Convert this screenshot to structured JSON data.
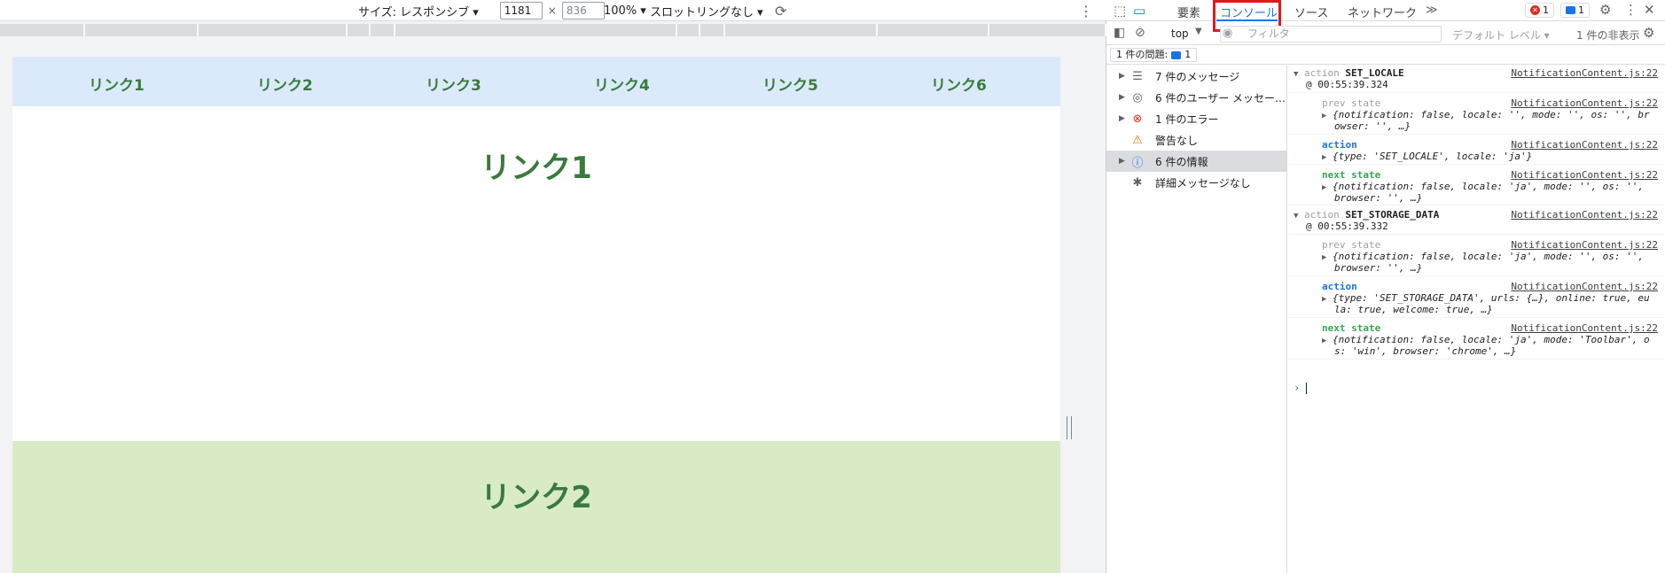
{
  "device_toolbar": {
    "size_label": "サイズ: レスポンシブ ▾",
    "width_value": "1181",
    "height_value": "836",
    "times": "×",
    "zoom": "100% ▾",
    "throttle": "スロットリングなし ▾"
  },
  "page": {
    "nav": [
      "リンク1",
      "リンク2",
      "リンク3",
      "リンク4",
      "リンク5",
      "リンク6"
    ],
    "section1_title": "リンク1",
    "section2_title": "リンク2",
    "section1_bg": "#ffffff",
    "section2_bg": "#d9ebc4",
    "nav_bg": "#dbeafb",
    "text_color": "#3a7a3e"
  },
  "devtools": {
    "tabs": [
      "要素",
      "コンソール",
      "ソース",
      "ネットワーク"
    ],
    "active_tab": "コンソール",
    "more_tabs": "≫",
    "error_badge": "1",
    "message_badge": "1",
    "context": "top",
    "filter_placeholder": "フィルタ",
    "levels": "デフォルト レベル ▾",
    "hidden": "1 件の非表示",
    "issues": "1 件の問題:",
    "issues_count": "1",
    "sidebar": [
      {
        "label": "7 件のメッセージ",
        "icon": "list-icon"
      },
      {
        "label": "6 件のユーザー メッセー…",
        "icon": "user-icon"
      },
      {
        "label": "1 件のエラー",
        "icon": "error-icon"
      },
      {
        "label": "警告なし",
        "icon": "warning-icon"
      },
      {
        "label": "6 件の情報",
        "icon": "info-icon"
      },
      {
        "label": "詳細メッセージなし",
        "icon": "bug-icon"
      }
    ],
    "console": {
      "file": "NotificationContent.js:22",
      "g1_head": "action",
      "g1_name": "SET_LOCALE",
      "g1_time": "@ 00:55:39.324",
      "g1_prev_label": "prev state",
      "g1_prev_1": "{notification: false, locale: '', mode: '', os: '', br",
      "g1_prev_2": "owser: '', …}",
      "g1_action_label": "action",
      "g1_action_1": "{type: 'SET_LOCALE', locale: 'ja'}",
      "g1_next_label": "next state",
      "g1_next_1": "{notification: false, locale: 'ja', mode: '', os: '',",
      "g1_next_2": "browser: '', …}",
      "g2_head": "action",
      "g2_name": "SET_STORAGE_DATA",
      "g2_time": "@ 00:55:39.332",
      "g2_prev_label": "prev state",
      "g2_prev_1": "{notification: false, locale: 'ja', mode: '', os: '',",
      "g2_prev_2": "browser: '', …}",
      "g2_action_label": "action",
      "g2_action_1": "{type: 'SET_STORAGE_DATA', urls: {…}, online: true, eu",
      "g2_action_2": "la: true, welcome: true, …}",
      "g2_next_label": "next state",
      "g2_next_1": "{notification: false, locale: 'ja', mode: 'Toolbar', o",
      "g2_next_2": "s: 'win', browser: 'chrome', …}"
    }
  },
  "colors": {
    "accent": "#1a73e8",
    "highlight_box": "#e0191e",
    "error": "#d93025"
  }
}
